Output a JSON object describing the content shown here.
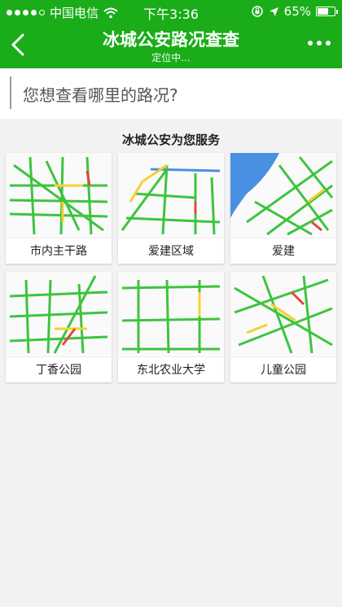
{
  "status_bar": {
    "carrier": "中国电信",
    "time": "下午3:36",
    "battery": "65%",
    "battery_level": 0.65
  },
  "header": {
    "title": "冰城公安路况查查",
    "subtitle": "定位中..."
  },
  "search": {
    "placeholder": "您想查看哪里的路况?"
  },
  "section": {
    "title": "冰城公安为您服务"
  },
  "areas": [
    {
      "label": "市内主干路"
    },
    {
      "label": "爱建区域"
    },
    {
      "label": "爱建"
    },
    {
      "label": "丁香公园"
    },
    {
      "label": "东北农业大学"
    },
    {
      "label": "儿童公园"
    }
  ],
  "colors": {
    "brand": "#1aad19",
    "road_clear": "#3ec43e",
    "road_slow": "#f5d033",
    "road_jam": "#e04a3a",
    "water": "#4a90e2"
  },
  "icons": [
    "signal-icon",
    "wifi-icon",
    "lock-rotation-icon",
    "location-arrow-icon",
    "battery-icon",
    "back-arrow-icon",
    "more-icon"
  ]
}
